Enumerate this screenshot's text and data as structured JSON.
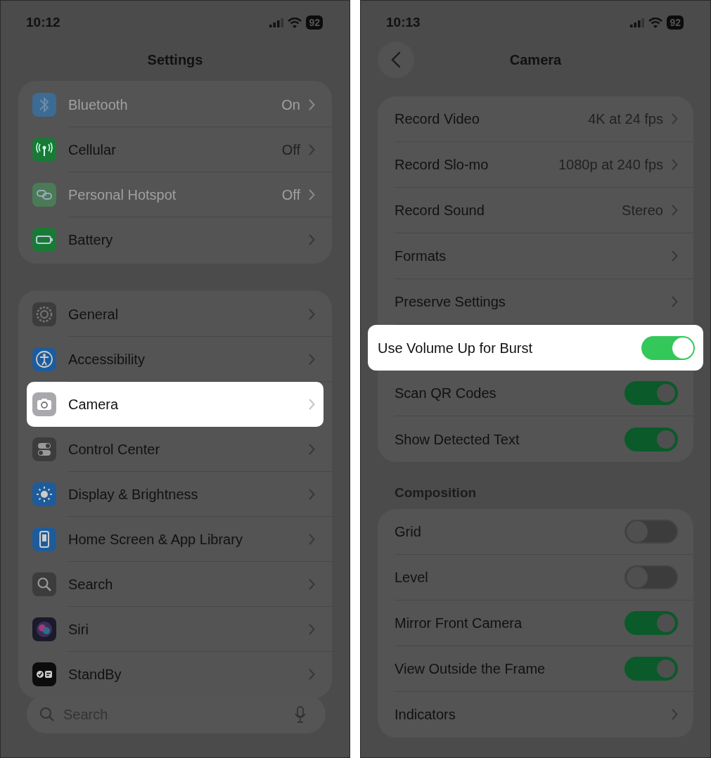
{
  "left_screen": {
    "status_bar": {
      "time": "10:12",
      "battery": "92"
    },
    "title": "Settings",
    "groups": [
      {
        "items": [
          {
            "label": "Bluetooth",
            "value": "On",
            "kind": "bluetooth",
            "color": "#3c6b94",
            "dimmed": true,
            "highlighted": false
          },
          {
            "label": "Cellular",
            "value": "Off",
            "kind": "antenna",
            "color": "#187a35",
            "dimmed": false,
            "highlighted": false
          },
          {
            "label": "Personal Hotspot",
            "value": "Off",
            "kind": "link",
            "color": "#4b7a56",
            "dimmed": true,
            "highlighted": false
          },
          {
            "label": "Battery",
            "kind": "battery",
            "color": "#187a35",
            "dimmed": false,
            "highlighted": false
          }
        ]
      },
      {
        "items": [
          {
            "label": "General",
            "kind": "gear",
            "color": "#3c3c3c",
            "dimmed": false,
            "highlighted": false
          },
          {
            "label": "Accessibility",
            "kind": "person",
            "color": "#1d5c9c",
            "dimmed": false,
            "highlighted": false
          },
          {
            "label": "Camera",
            "kind": "camera",
            "color": "#a9a9ad",
            "dimmed": false,
            "highlighted": true
          },
          {
            "label": "Control Center",
            "kind": "switches",
            "color": "#3c3c3c",
            "dimmed": false,
            "highlighted": false
          },
          {
            "label": "Display & Brightness",
            "kind": "sun",
            "color": "#1d5c9c",
            "dimmed": false,
            "highlighted": false
          },
          {
            "label": "Home Screen & App Library",
            "kind": "phone",
            "color": "#1d5c9c",
            "dimmed": false,
            "highlighted": false
          },
          {
            "label": "Search",
            "kind": "search",
            "color": "#3c3c3c",
            "dimmed": false,
            "highlighted": false
          },
          {
            "label": "Siri",
            "kind": "orb",
            "color": "#1a1a2a",
            "dimmed": false,
            "highlighted": false
          },
          {
            "label": "StandBy",
            "kind": "standby",
            "color": "#0c0c0c",
            "dimmed": false,
            "highlighted": false
          }
        ]
      }
    ],
    "search": {
      "placeholder": "Search"
    }
  },
  "right_screen": {
    "status_bar": {
      "time": "10:13",
      "battery": "92"
    },
    "title": "Camera",
    "sections": [
      {
        "rows": [
          {
            "label": "Record Video",
            "value": "4K at 24 fps",
            "kind": "link",
            "highlighted": false
          },
          {
            "label": "Record Slo-mo",
            "value": "1080p at 240 fps",
            "kind": "link",
            "highlighted": false
          },
          {
            "label": "Record Sound",
            "value": "Stereo",
            "kind": "link",
            "highlighted": false
          },
          {
            "label": "Formats",
            "kind": "link",
            "highlighted": false
          },
          {
            "label": "Preserve Settings",
            "kind": "link",
            "highlighted": false
          },
          {
            "label": "Use Volume Up for Burst",
            "kind": "toggle",
            "on": true,
            "highlighted": true
          },
          {
            "label": "Scan QR Codes",
            "kind": "toggle",
            "on": true,
            "highlighted": false
          },
          {
            "label": "Show Detected Text",
            "kind": "toggle",
            "on": true,
            "highlighted": false
          }
        ]
      },
      {
        "header": "Composition",
        "rows": [
          {
            "label": "Grid",
            "kind": "toggle",
            "on": false,
            "highlighted": false
          },
          {
            "label": "Level",
            "kind": "toggle",
            "on": false,
            "highlighted": false
          },
          {
            "label": "Mirror Front Camera",
            "kind": "toggle",
            "on": true,
            "highlighted": false
          },
          {
            "label": "View Outside the Frame",
            "kind": "toggle",
            "on": true,
            "highlighted": false
          },
          {
            "label": "Indicators",
            "kind": "link",
            "highlighted": false
          }
        ]
      }
    ]
  }
}
